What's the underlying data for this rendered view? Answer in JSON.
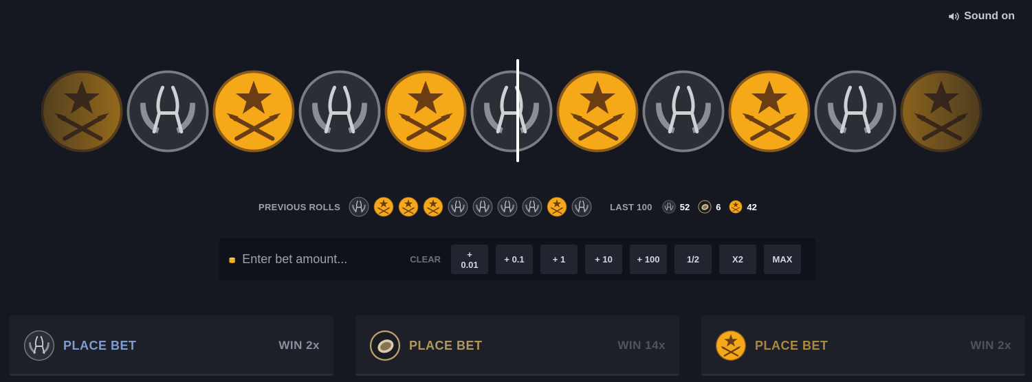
{
  "sound": {
    "label": "Sound on",
    "icon": "speaker-icon"
  },
  "roulette": {
    "strip": [
      "t",
      "ct",
      "t",
      "ct",
      "t",
      "ct",
      "t",
      "ct",
      "t",
      "ct",
      "t"
    ],
    "pointer": "roll-pointer"
  },
  "history": {
    "label": "PREVIOUS ROLLS",
    "rolls": [
      "ct",
      "t",
      "t",
      "t",
      "ct",
      "ct",
      "ct",
      "ct",
      "t",
      "ct"
    ]
  },
  "last100": {
    "label": "LAST 100",
    "stats": [
      {
        "type": "ct",
        "count": "52"
      },
      {
        "type": "bonus",
        "count": "6"
      },
      {
        "type": "t",
        "count": "42"
      }
    ]
  },
  "bet": {
    "placeholder": "Enter bet amount...",
    "clear_label": "CLEAR",
    "quick_buttons": [
      "+ 0.01",
      "+ 0.1",
      "+ 1",
      "+ 10",
      "+ 100",
      "1/2",
      "X2",
      "MAX"
    ]
  },
  "cards": [
    {
      "type": "ct",
      "place_label": "PLACE BET",
      "win_label": "WIN 2x"
    },
    {
      "type": "bonus",
      "place_label": "PLACE BET",
      "win_label": "WIN 14x"
    },
    {
      "type": "t",
      "place_label": "PLACE BET",
      "win_label": "WIN 2x"
    }
  ],
  "colors": {
    "background": "#161821",
    "t_gold": "#f5a818",
    "ct_grey": "#2c2e36",
    "ct_label": "#7f9bd0",
    "t_label": "#a9893f"
  }
}
